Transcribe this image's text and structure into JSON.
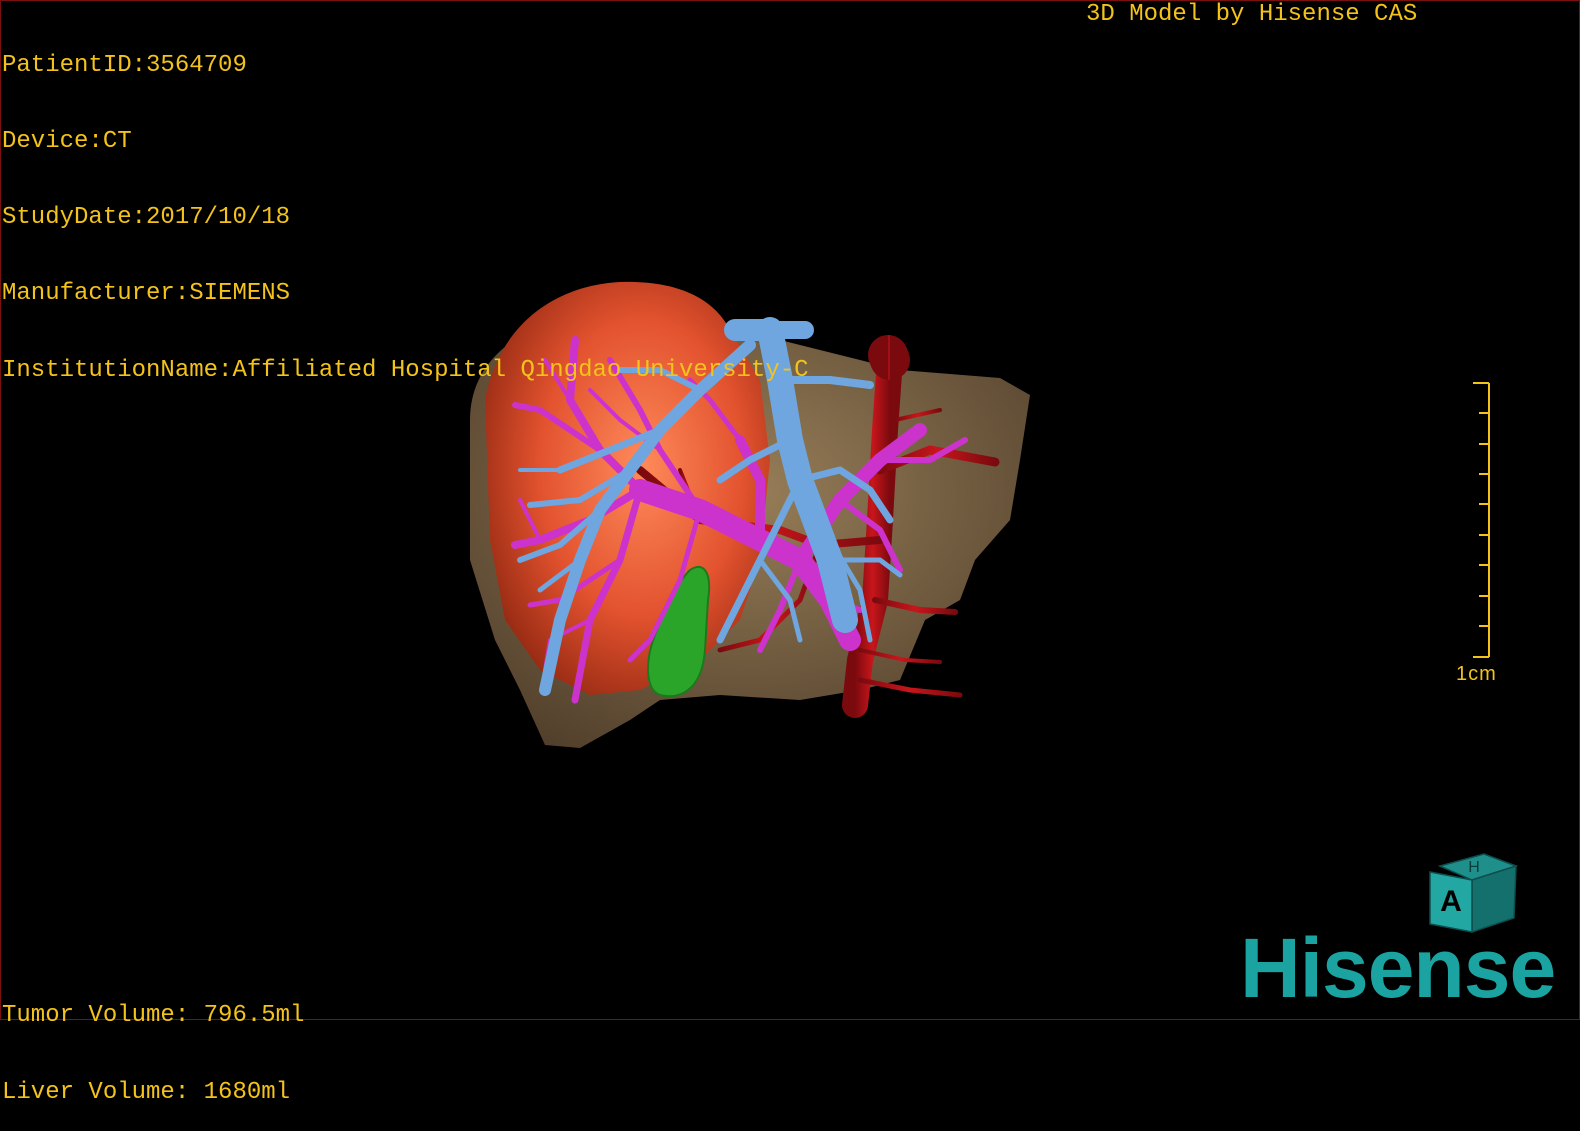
{
  "header": {
    "patient_id": "PatientID:3564709",
    "device": "Device:CT",
    "study_date": "StudyDate:2017/10/18",
    "manufacturer": "Manufacturer:SIEMENS",
    "institution": "InstitutionName:Affiliated Hospital Qingdao University-C"
  },
  "brand_top": "3D Model by Hisense CAS",
  "volumes": {
    "tumor": "Tumor Volume: 796.5ml",
    "liver": "Liver Volume: 1680ml"
  },
  "scale": {
    "label": "1cm"
  },
  "orientation_cube": {
    "front": "A",
    "top": "H"
  },
  "logo": "Hisense",
  "colors": {
    "overlay_text": "#f3c21b",
    "liver": "#8a7150",
    "tumor": "#e2522e",
    "hepatic_vein": "#6fa6df",
    "portal_vein": "#cc33cc",
    "artery": "#b01418",
    "gallbladder": "#2aa52a",
    "logo": "#1aa3a0"
  },
  "icons": [
    "orientation-cube-icon",
    "hisense-logo"
  ]
}
